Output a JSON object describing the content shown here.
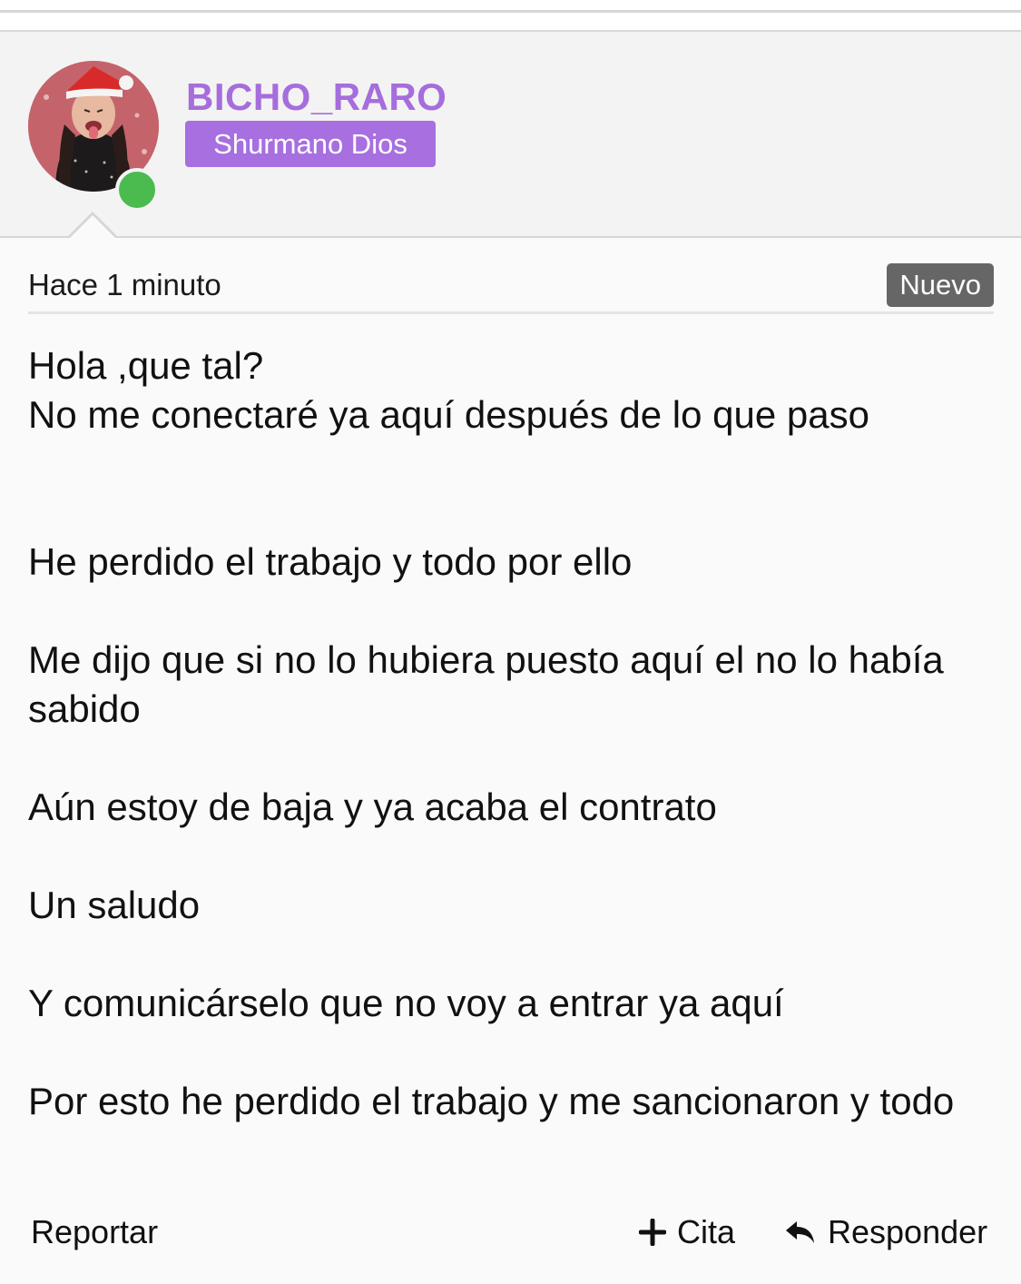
{
  "post": {
    "username": "BICHO_RARO",
    "rank": "Shurmano Dios",
    "time": "Hace 1 minuto",
    "badge": "Nuevo",
    "lines": [
      "Hola ,que tal?",
      "No me conectaré ya aquí después de lo que paso",
      "He perdido el trabajo y todo por ello",
      "Me dijo que si no lo hubiera puesto aquí el no lo había sabido",
      "Aún estoy de baja y ya acaba el contrato",
      "Un saludo",
      "Y comunicárselo que no voy a entrar ya aquí",
      "Por esto he perdido el trabajo y me sancionaron y todo"
    ]
  },
  "actions": {
    "report": "Reportar",
    "quote": "Cita",
    "reply": "Responder"
  },
  "colors": {
    "username": "#a66ddc",
    "rank_badge": "#a76fe0",
    "online": "#4bbb4f",
    "new_badge": "#666666"
  },
  "icons": {
    "quote": "plus-icon",
    "reply": "reply-arrow-icon",
    "status": "online-status-dot"
  }
}
